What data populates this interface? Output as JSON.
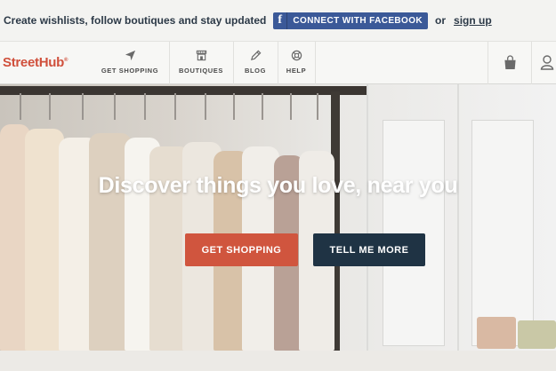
{
  "promo": {
    "text": "Create wishlists, follow boutiques and stay updated",
    "facebook_icon": "f",
    "facebook_label": "CONNECT WITH FACEBOOK",
    "or_text": "or",
    "signup_label": "sign up"
  },
  "nav": {
    "logo": "StreetHub",
    "logo_mark": "®",
    "items": [
      {
        "label": "GET SHOPPING",
        "icon": "send-icon"
      },
      {
        "label": "BOUTIQUES",
        "icon": "storefront-icon"
      },
      {
        "label": "BLOG",
        "icon": "pencil-icon"
      },
      {
        "label": "HELP",
        "icon": "lifebuoy-icon"
      }
    ],
    "right_icons": [
      "shopping-bag-icon",
      "user-icon"
    ]
  },
  "hero": {
    "title": "Discover things you love, near you",
    "primary_button": "GET SHOPPING",
    "secondary_button": "TELL ME MORE"
  },
  "colors": {
    "brand": "#d0503c",
    "primary_button": "#d0553e",
    "secondary_button": "#1f3344",
    "facebook": "#3b5998",
    "text_dark": "#2c3947"
  }
}
